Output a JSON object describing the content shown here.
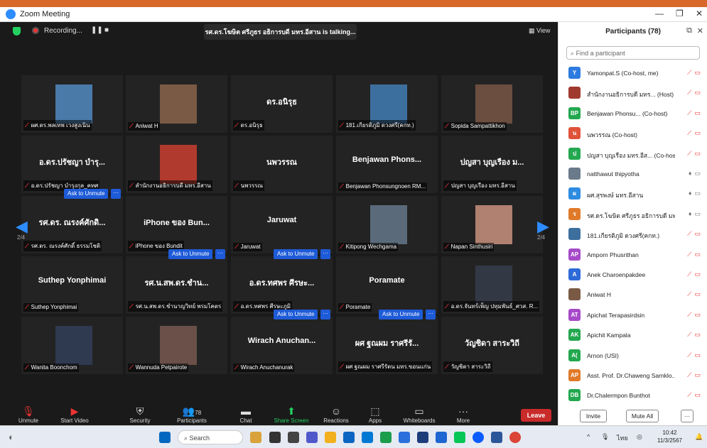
{
  "window": {
    "title": "Zoom Meeting"
  },
  "topbar": {
    "recording_label": "Recording...",
    "talking": "รศ.ดร.โฆษิต ศรีภูธร อธิการบดี มทร.อีสาน is talking...",
    "view_label": "View"
  },
  "tiles": [
    {
      "label": "ผศ.ดร.พลเทพ เวงสูงเนิน",
      "big": "",
      "photo": "#4a7aa8",
      "mic_off": true
    },
    {
      "label": "Aniwat H",
      "big": "",
      "photo": "#7a5a44",
      "mic_off": true
    },
    {
      "label": "ดร.อนิรุธ",
      "big": "ดร.อนิรุธ",
      "photo": "",
      "mic_off": true
    },
    {
      "label": "181.เกียรติภูมิ ดวงศรี(คกท.)",
      "big": "",
      "photo": "#3d6f9e",
      "mic_off": true
    },
    {
      "label": "Sopida Sampattikhon",
      "big": "",
      "photo": "#6b4e3f",
      "mic_off": true
    },
    {
      "label": "อ.ดร.ปรัชญา บำรุงกุล_คทศ",
      "big": "อ.ดร.ปรัชญา บำรุ...",
      "photo": "",
      "mic_off": true
    },
    {
      "label": "สำนักงานอธิการบดี มทร.อีสาน",
      "big": "",
      "photo": "#b03a2e",
      "mic_off": true
    },
    {
      "label": "นพวรรณ",
      "big": "นพวรรณ",
      "photo": "",
      "mic_off": true
    },
    {
      "label": "Benjawan Phonsungnoen RM...",
      "big": "Benjawan Phons...",
      "photo": "",
      "mic_off": true
    },
    {
      "label": "ปญสา บุญเรือง มทร.อีสาน",
      "big": "ปญสา บุญเรือง ม...",
      "photo": "",
      "mic_off": true
    },
    {
      "label": "รศ.ดร. ณรงค์ศักดิ์ ธรรมโชติ",
      "big": "รศ.ดร. ณรงค์ศักดิ...",
      "photo": "",
      "mic_off": true
    },
    {
      "label": "iPhone ของ Bundit",
      "big": "iPhone ของ Bun...",
      "photo": "",
      "mic_off": true
    },
    {
      "label": "Jaruwat",
      "big": "Jaruwat",
      "photo": "",
      "mic_off": true
    },
    {
      "label": "Kitipong Wechgama",
      "big": "",
      "photo": "#5a6a7a",
      "mic_off": true
    },
    {
      "label": "Napan Sinthusiri",
      "big": "",
      "photo": "#b08070",
      "mic_off": true
    },
    {
      "label": "Suthep Yonphimai",
      "big": "Suthep Yonphimai",
      "photo": "",
      "mic_off": true
    },
    {
      "label": "รศ.น.สพ.ดร.ชำนาญวิทย์ พรมโคตร",
      "big": "รศ.น.สพ.ดร.ชำน...",
      "photo": "",
      "mic_off": true
    },
    {
      "label": "อ.ดร.ทศพร ศีรษะภูมิ",
      "big": "อ.ดร.ทศพร ศีรษะ...",
      "photo": "",
      "mic_off": true
    },
    {
      "label": "Poramate",
      "big": "Poramate",
      "photo": "",
      "mic_off": true
    },
    {
      "label": "อ.ดร.จันทร์เพ็ญ ปทุมพันธ์_ศวส. R...",
      "big": "",
      "photo": "#333845",
      "mic_off": true
    },
    {
      "label": "Wanita Boonchom",
      "big": "",
      "photo": "#2f3a50",
      "mic_off": true
    },
    {
      "label": "Wannuda Petpairote",
      "big": "",
      "photo": "#6a5048",
      "mic_off": true
    },
    {
      "label": "Wirach Anuchanurak",
      "big": "Wirach Anuchan...",
      "photo": "",
      "mic_off": true
    },
    {
      "label": "ผศ ฐณผม ราศรีรัตน มทร.ขอนแก่น",
      "big": "ผศ ฐณผม ราศรีรั...",
      "photo": "",
      "mic_off": true
    },
    {
      "label": "วัญชิดา สาระวิถี",
      "big": "วัญชิดา สาระวิถี",
      "photo": "",
      "mic_off": true
    }
  ],
  "unmute": {
    "label": "Ask to Unmute",
    "more": "···"
  },
  "pager": {
    "left": "2/4",
    "right": "2/4"
  },
  "toolbar": {
    "unmute": "Unmute",
    "video": "Start Video",
    "security": "Security",
    "participants": "Participants",
    "participants_count": "78",
    "chat": "Chat",
    "share": "Share Screen",
    "reactions": "Reactions",
    "apps": "Apps",
    "whiteboards": "Whiteboards",
    "more": "More",
    "leave": "Leave"
  },
  "panel": {
    "title": "Participants (78)",
    "search_placeholder": "Find a participant",
    "invite": "Invite",
    "mute_all": "Mute All",
    "more": "···",
    "participants": [
      {
        "name": "Yamonpat.S (Co-host, me)",
        "initials": "Y",
        "color": "#2d7be0",
        "muted": true,
        "video_off": true
      },
      {
        "name": "สำนักงานอธิการบดี มทร... (Host)",
        "initials": "",
        "color": "#a03a2e",
        "muted": true,
        "video_off": true
      },
      {
        "name": "Benjawan Phonsu... (Co-host)",
        "initials": "BP",
        "color": "#23a84f",
        "muted": true,
        "video_off": true
      },
      {
        "name": "นพวรรณ (Co-host)",
        "initials": "น",
        "color": "#e0533a",
        "muted": true,
        "video_off": true
      },
      {
        "name": "ปญสา บุญเรือง มทร.อีส... (Co-host)",
        "initials": "ป",
        "color": "#23a84f",
        "muted": true,
        "video_off": true
      },
      {
        "name": "natthawut thipyotha",
        "initials": "",
        "color": "#6a7a8a",
        "muted": false,
        "video_off": true
      },
      {
        "name": "ผศ.สุรพงษ์ มทร.อีสาน",
        "initials": "ผ",
        "color": "#2d8ce0",
        "muted": false,
        "video_off": true
      },
      {
        "name": "รศ.ดร.โฆษิต ศรีภูธร อธิการบดี มทร....",
        "initials": "ร",
        "color": "#e07a2a",
        "muted": false,
        "video_off": true
      },
      {
        "name": "181.เกียรติภูมิ ดวงศรี(คกท.)",
        "initials": "",
        "color": "#3d6f9e",
        "muted": true,
        "video_off": true
      },
      {
        "name": "Amporn Phusrithan",
        "initials": "AP",
        "color": "#a64ac9",
        "muted": true,
        "video_off": true
      },
      {
        "name": "Anek Charoenpakdee",
        "initials": "A",
        "color": "#2d6ad8",
        "muted": true,
        "video_off": true
      },
      {
        "name": "Aniwat H",
        "initials": "",
        "color": "#7a5a44",
        "muted": true,
        "video_off": true
      },
      {
        "name": "Apichat Terapasirdsin",
        "initials": "AT",
        "color": "#a64ac9",
        "muted": true,
        "video_off": true
      },
      {
        "name": "Apichit Kampala",
        "initials": "AK",
        "color": "#23a84f",
        "muted": true,
        "video_off": true
      },
      {
        "name": "Arnon (USI)",
        "initials": "A(",
        "color": "#23a84f",
        "muted": true,
        "video_off": true
      },
      {
        "name": "Asst. Prof. Dr.Chaweng Sarnklo...",
        "initials": "AP",
        "color": "#e07a2a",
        "muted": true,
        "video_off": true
      },
      {
        "name": "Dr.Chalermpon Bunthot",
        "initials": "DB",
        "color": "#23a84f",
        "muted": true,
        "video_off": true
      }
    ]
  },
  "taskbar": {
    "search": "Search",
    "time": "10:42",
    "date": "11/3/2567",
    "lang": "ไทย"
  }
}
